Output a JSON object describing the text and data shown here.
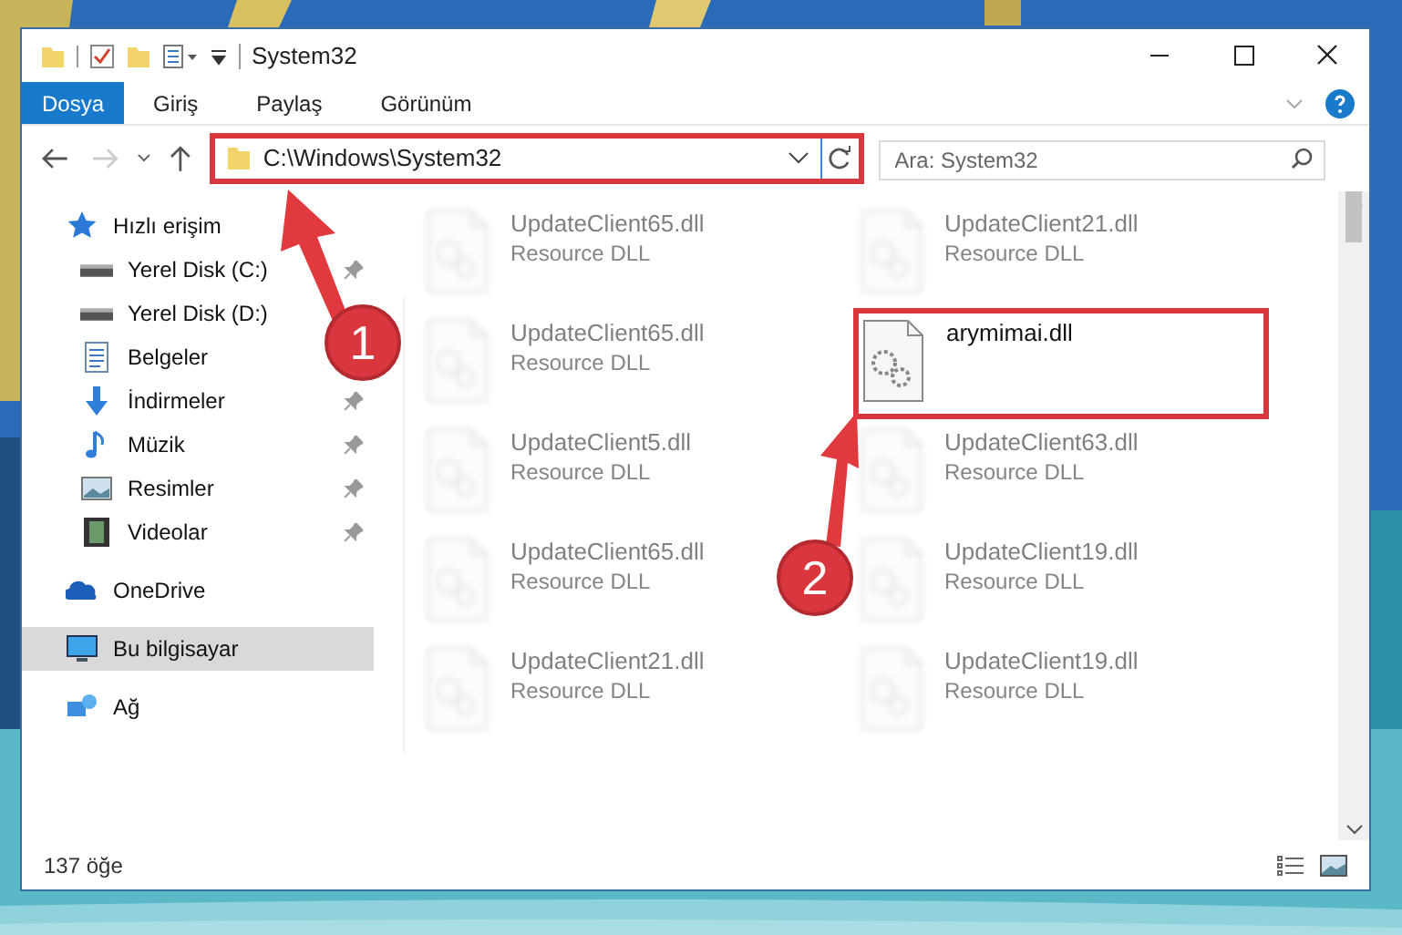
{
  "window": {
    "title": "System32"
  },
  "tabs": [
    {
      "label": "Dosya",
      "selected": true
    },
    {
      "label": "Giriş",
      "selected": false
    },
    {
      "label": "Paylaş",
      "selected": false
    },
    {
      "label": "Görünüm",
      "selected": false
    }
  ],
  "address": {
    "path": "C:\\Windows\\System32",
    "highlighted": true
  },
  "search": {
    "placeholder": "Ara: System32"
  },
  "sidebar": {
    "items": [
      {
        "label": "Hızlı erişim",
        "selected": false,
        "children": [
          {
            "label": "Yerel Disk (C:)",
            "pinned": true
          },
          {
            "label": "Yerel Disk (D:)",
            "pinned": false
          },
          {
            "label": "Belgeler",
            "pinned": false
          },
          {
            "label": "İndirmeler",
            "pinned": true
          },
          {
            "label": "Müzik",
            "pinned": true
          },
          {
            "label": "Resimler",
            "pinned": true
          },
          {
            "label": "Videolar",
            "pinned": true
          }
        ]
      },
      {
        "label": "OneDrive",
        "selected": false
      },
      {
        "label": "Bu bilgisayar",
        "selected": true
      },
      {
        "label": "Ağ",
        "selected": false
      }
    ]
  },
  "files": [
    {
      "name": "UpdateClient65.dll",
      "description": "Resource DLL",
      "blurred": true,
      "highlighted": false
    },
    {
      "name": "UpdateClient21.dll",
      "description": "Resource DLL",
      "blurred": true,
      "highlighted": false
    },
    {
      "name": "UpdateClient65.dll",
      "description": "Resource DLL",
      "blurred": true,
      "highlighted": false
    },
    {
      "name": "arymimai.dll",
      "blurred": false,
      "highlighted": true
    },
    {
      "name": "UpdateClient5.dll",
      "description": "Resource DLL",
      "blurred": true,
      "highlighted": false
    },
    {
      "name": "UpdateClient63.dll",
      "description": "Resource DLL",
      "blurred": true,
      "highlighted": false
    },
    {
      "name": "UpdateClient65.dll",
      "description": "Resource DLL",
      "blurred": true,
      "highlighted": false
    },
    {
      "name": "UpdateClient19.dll",
      "description": "Resource DLL",
      "blurred": true,
      "highlighted": false
    },
    {
      "name": "UpdateClient21.dll",
      "description": "Resource DLL",
      "blurred": true,
      "highlighted": false
    },
    {
      "name": "UpdateClient19.dll",
      "description": "Resource DLL",
      "blurred": true,
      "highlighted": false
    }
  ],
  "status_bar": {
    "count": "137 öğe"
  },
  "annotations": [
    {
      "label": "1"
    },
    {
      "label": "2"
    }
  ]
}
